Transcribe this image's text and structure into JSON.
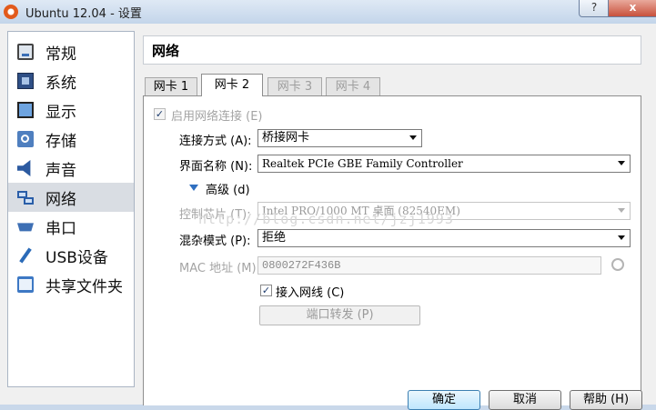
{
  "window": {
    "title": "Ubuntu 12.04 - 设置",
    "help_label": "?",
    "close_label": "x"
  },
  "sidebar": {
    "items": [
      {
        "label": "常规",
        "icon": "general-icon"
      },
      {
        "label": "系统",
        "icon": "system-icon"
      },
      {
        "label": "显示",
        "icon": "display-icon"
      },
      {
        "label": "存储",
        "icon": "storage-icon"
      },
      {
        "label": "声音",
        "icon": "audio-icon"
      },
      {
        "label": "网络",
        "icon": "network-icon",
        "selected": true
      },
      {
        "label": "串口",
        "icon": "serial-port-icon"
      },
      {
        "label": "USB设备",
        "icon": "usb-icon"
      },
      {
        "label": "共享文件夹",
        "icon": "shared-folder-icon"
      }
    ]
  },
  "header": {
    "title": "网络"
  },
  "tabs": [
    {
      "label": "网卡 1",
      "state": "normal"
    },
    {
      "label": "网卡 2",
      "state": "active"
    },
    {
      "label": "网卡 3",
      "state": "disabled"
    },
    {
      "label": "网卡 4",
      "state": "disabled"
    }
  ],
  "form": {
    "enable_label": "启用网络连接 (E)",
    "enable_checked": true,
    "attached_label": "连接方式 (A):",
    "attached_value": "桥接网卡",
    "name_label": "界面名称 (N):",
    "name_value": "Realtek PCIe GBE Family Controller",
    "advanced_label": "高级 (d)",
    "adapter_type_label": "控制芯片 (T):",
    "adapter_type_value": "Intel PRO/1000 MT 桌面 (82540EM)",
    "promisc_label": "混杂模式 (P):",
    "promisc_value": "拒绝",
    "mac_label": "MAC 地址 (M):",
    "mac_value": "0800272F436B",
    "cable_label": "接入网线 (C)",
    "cable_checked": true,
    "port_forward_label": "端口转发 (P)"
  },
  "watermark": "http://blog.csdn.net/jzj1993",
  "buttons": {
    "ok": "确定",
    "cancel": "取消",
    "help": "帮助 (H)"
  }
}
